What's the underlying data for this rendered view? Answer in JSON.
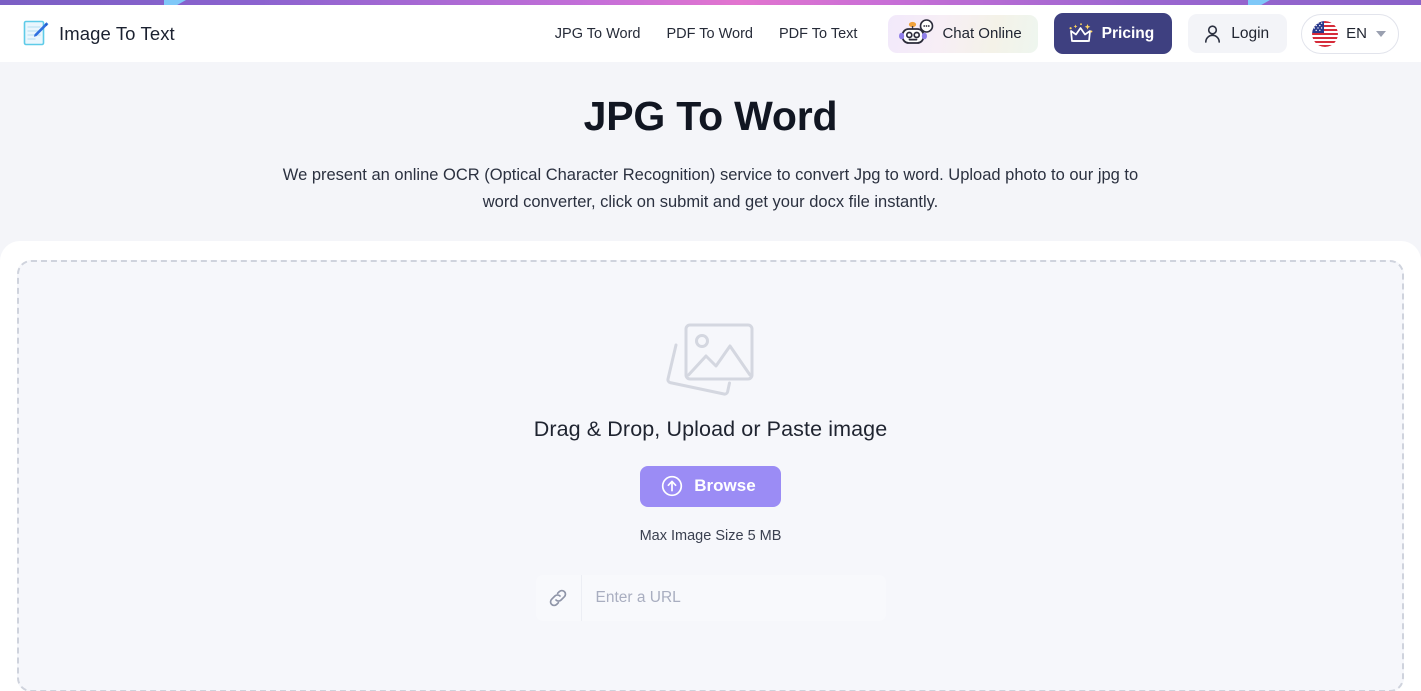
{
  "topbar": {
    "gradient_from": "#7b5fc4",
    "gradient_mid": "#e274cf",
    "gradient_to": "#8a62c9",
    "marker_color": "#7fc8f8"
  },
  "header": {
    "logo_icon": "document-pen-icon",
    "brand": "Image To Text",
    "nav": [
      {
        "label": "JPG To Word",
        "name": "nav-jpg-to-word"
      },
      {
        "label": "PDF To Word",
        "name": "nav-pdf-to-word"
      },
      {
        "label": "PDF To Text",
        "name": "nav-pdf-to-text"
      }
    ],
    "chat": {
      "label": "Chat Online",
      "icon": "robot-icon"
    },
    "pricing": {
      "label": "Pricing",
      "icon": "crown-sparkle-icon",
      "bg": "#3e4080"
    },
    "login": {
      "label": "Login",
      "icon": "user-icon"
    },
    "language": {
      "label": "EN",
      "flag": "us-flag-icon",
      "caret": "chevron-down-icon"
    }
  },
  "hero": {
    "title": "JPG To Word",
    "description": "We present an online OCR (Optical Character Recognition) service to convert Jpg to word. Upload photo to our jpg to word converter, click on submit and get your docx file instantly."
  },
  "dropzone": {
    "placeholder_icon": "image-placeholder-icon",
    "title": "Drag & Drop, Upload or Paste image",
    "browse_label": "Browse",
    "browse_icon": "upload-arrow-circle-icon",
    "browse_color": "#9b8cf5",
    "max_size_note": "Max Image Size 5 MB",
    "url_icon": "link-icon",
    "url_value": "",
    "url_placeholder": "Enter a URL"
  }
}
